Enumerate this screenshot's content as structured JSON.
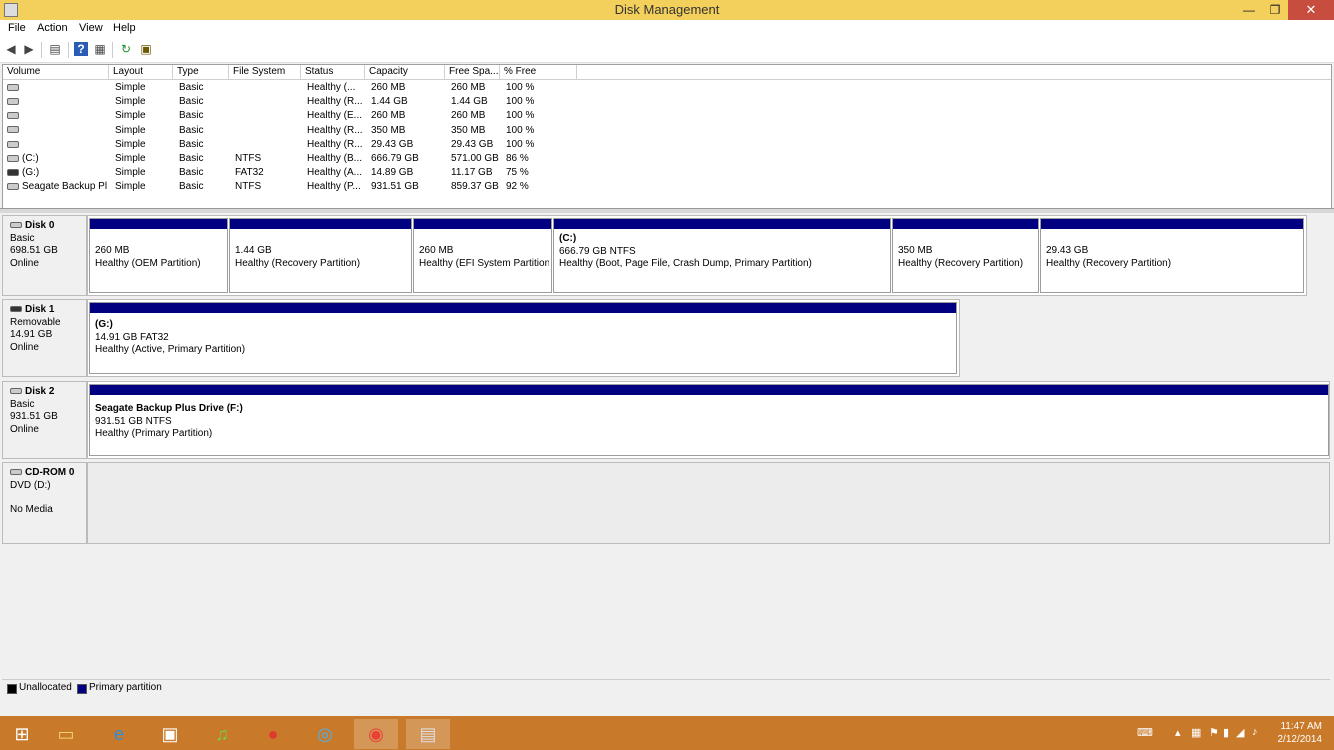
{
  "window": {
    "title": "Disk Management",
    "minimize": "—",
    "maximize": "❐",
    "close": "✕"
  },
  "menu": [
    "File",
    "Action",
    "View",
    "Help"
  ],
  "columns": [
    "Volume",
    "Layout",
    "Type",
    "File System",
    "Status",
    "Capacity",
    "Free Spa...",
    "% Free"
  ],
  "volumes": [
    {
      "volume": "",
      "layout": "Simple",
      "type": "Basic",
      "fs": "",
      "status": "Healthy (...",
      "capacity": "260 MB",
      "free": "260 MB",
      "pct": "100 %"
    },
    {
      "volume": "",
      "layout": "Simple",
      "type": "Basic",
      "fs": "",
      "status": "Healthy (R...",
      "capacity": "1.44 GB",
      "free": "1.44 GB",
      "pct": "100 %"
    },
    {
      "volume": "",
      "layout": "Simple",
      "type": "Basic",
      "fs": "",
      "status": "Healthy (E...",
      "capacity": "260 MB",
      "free": "260 MB",
      "pct": "100 %"
    },
    {
      "volume": "",
      "layout": "Simple",
      "type": "Basic",
      "fs": "",
      "status": "Healthy (R...",
      "capacity": "350 MB",
      "free": "350 MB",
      "pct": "100 %"
    },
    {
      "volume": "",
      "layout": "Simple",
      "type": "Basic",
      "fs": "",
      "status": "Healthy (R...",
      "capacity": "29.43 GB",
      "free": "29.43 GB",
      "pct": "100 %"
    },
    {
      "volume": "(C:)",
      "layout": "Simple",
      "type": "Basic",
      "fs": "NTFS",
      "status": "Healthy (B...",
      "capacity": "666.79 GB",
      "free": "571.00 GB",
      "pct": "86 %"
    },
    {
      "volume": "(G:)",
      "layout": "Simple",
      "type": "Basic",
      "fs": "FAT32",
      "status": "Healthy (A...",
      "capacity": "14.89 GB",
      "free": "11.17 GB",
      "pct": "75 %"
    },
    {
      "volume": "Seagate Backup Pl...",
      "layout": "Simple",
      "type": "Basic",
      "fs": "NTFS",
      "status": "Healthy (P...",
      "capacity": "931.51 GB",
      "free": "859.37 GB",
      "pct": "92 %"
    }
  ],
  "disks": [
    {
      "name": "Disk 0",
      "kind": "Basic",
      "size": "698.51 GB",
      "state": "Online",
      "partitions": [
        {
          "title": "",
          "size": "260 MB",
          "status": "Healthy (OEM Partition)"
        },
        {
          "title": "",
          "size": "1.44 GB",
          "status": "Healthy (Recovery Partition)"
        },
        {
          "title": "",
          "size": "260 MB",
          "status": "Healthy (EFI System Partition"
        },
        {
          "title": "(C:)",
          "size": "666.79 GB NTFS",
          "status": "Healthy (Boot, Page File, Crash Dump, Primary Partition)"
        },
        {
          "title": "",
          "size": "350 MB",
          "status": "Healthy (Recovery Partition)"
        },
        {
          "title": "",
          "size": "29.43 GB",
          "status": "Healthy (Recovery Partition)"
        }
      ]
    },
    {
      "name": "Disk 1",
      "kind": "Removable",
      "size": "14.91 GB",
      "state": "Online",
      "partitions": [
        {
          "title": "(G:)",
          "size": "14.91 GB FAT32",
          "status": "Healthy (Active, Primary Partition)"
        }
      ]
    },
    {
      "name": "Disk 2",
      "kind": "Basic",
      "size": "931.51 GB",
      "state": "Online",
      "partitions": [
        {
          "title": "Seagate Backup Plus Drive  (F:)",
          "size": "931.51 GB NTFS",
          "status": "Healthy (Primary Partition)"
        }
      ]
    },
    {
      "name": "CD-ROM 0",
      "kind": "DVD (D:)",
      "size": "",
      "state": "No Media",
      "partitions": []
    }
  ],
  "legend": [
    {
      "label": "Unallocated",
      "color": "#000000"
    },
    {
      "label": "Primary partition",
      "color": "#000080"
    }
  ],
  "colors": {
    "titlebar": "#f3cf5c",
    "partition_bar": "#000080",
    "taskbar": "#c87a2a"
  },
  "taskbar": {
    "apps": [
      "windows-start-icon",
      "file-explorer-icon",
      "internet-explorer-icon",
      "media-app-icon",
      "music-app-icon",
      "record-app-icon",
      "disc-app-icon",
      "chrome-icon",
      "disk-management-icon"
    ],
    "time": "11:47 AM",
    "date": "2/12/2014"
  }
}
